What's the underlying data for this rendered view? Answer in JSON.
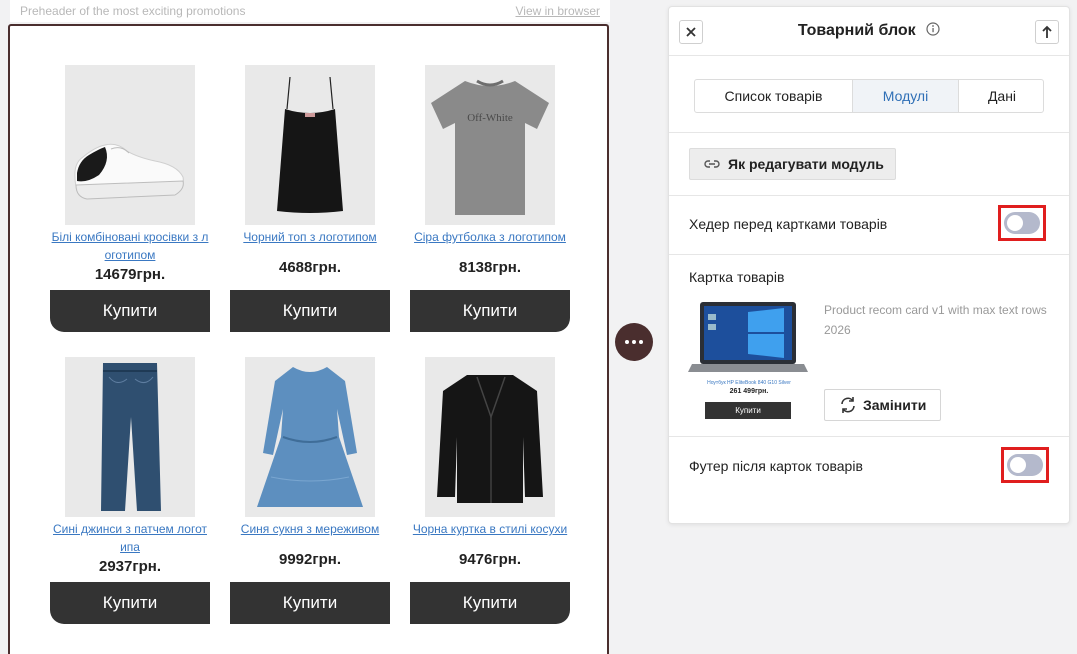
{
  "email": {
    "preheader": "Preheader of the most exciting promotions",
    "view_in_browser": "View in browser",
    "currency_suffix": "грн.",
    "products": [
      {
        "name_line1": "Білі комбіновані кросівки з л",
        "name_line2": "оготипом",
        "price": "14679грн.",
        "buy": "Купити",
        "image": "sneaker-image"
      },
      {
        "name_line1": "Чорний топ з логотипом",
        "name_line2": "",
        "price": "4688грн.",
        "buy": "Купити",
        "image": "tank-top-image"
      },
      {
        "name_line1": "Сіра футболка з логотипом",
        "name_line2": "",
        "price": "8138грн.",
        "buy": "Купити",
        "image": "tshirt-image"
      },
      {
        "name_line1": "Сині джинси з патчем логот",
        "name_line2": "ипа",
        "price": "2937грн.",
        "buy": "Купити",
        "image": "jeans-image"
      },
      {
        "name_line1": "Синя сукня з мереживом",
        "name_line2": "",
        "price": "9992грн.",
        "buy": "Купити",
        "image": "dress-image"
      },
      {
        "name_line1": "Чорна куртка в стилі косухи",
        "name_line2": "",
        "price": "9476грн.",
        "buy": "Купити",
        "image": "jacket-image"
      }
    ],
    "tshirt_logo_text": "Off-White"
  },
  "panel": {
    "title": "Товарний блок",
    "tabs": [
      {
        "label": "Список товарів",
        "active": false
      },
      {
        "label": "Модулі",
        "active": true
      },
      {
        "label": "Дані",
        "active": false
      }
    ],
    "edit_module_label": "Як редагувати модуль",
    "header_toggle_label": "Хедер перед картками товарів",
    "header_toggle_on": false,
    "card_section_label": "Картка товарів",
    "card_desc": "Product recom card v1 with max text rows 2026",
    "card_preview": {
      "name": "Ноутбук HP EliteBook 840 G10 Silver",
      "price": "261 499грн.",
      "buy": "Купити"
    },
    "replace_label": "Замінити",
    "footer_toggle_label": "Футер після карток товарів",
    "footer_toggle_on": false
  },
  "colors": {
    "buy_button": "#333333",
    "link": "#3a78c2",
    "active_tab": "#2f6fb6",
    "highlight": "#e01e1e",
    "toggle_off": "#b4b9cc",
    "frame": "#4a2e2e"
  }
}
